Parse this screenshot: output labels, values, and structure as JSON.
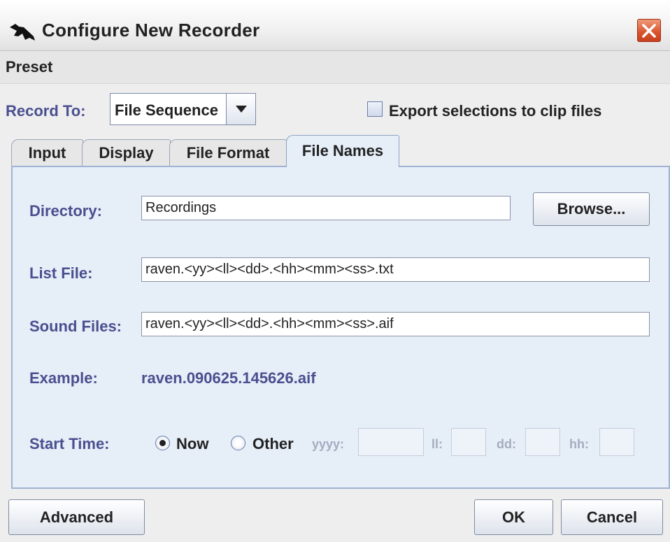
{
  "window": {
    "title": "Configure New Recorder",
    "menu": [
      "Preset"
    ]
  },
  "record": {
    "label": "Record To:",
    "selected": "File Sequence",
    "export_label": "Export selections to clip files",
    "export_checked": false
  },
  "tabs": [
    {
      "label": "Input",
      "active": false
    },
    {
      "label": "Display",
      "active": false
    },
    {
      "label": "File Format",
      "active": false
    },
    {
      "label": "File Names",
      "active": true
    }
  ],
  "file_names": {
    "directory_label": "Directory:",
    "directory_value": "Recordings",
    "browse_label": "Browse...",
    "list_file_label": "List File:",
    "list_file_value": "raven.<yy><ll><dd>.<hh><mm><ss>.txt",
    "sound_files_label": "Sound Files:",
    "sound_files_value": "raven.<yy><ll><dd>.<hh><mm><ss>.aif",
    "example_label": "Example:",
    "example_value": "raven.090625.145626.aif",
    "start_time_label": "Start Time:",
    "now_label": "Now",
    "now_selected": true,
    "other_label": "Other",
    "yyyy_label": "yyyy:",
    "ll_label": "ll:",
    "dd_label": "dd:",
    "hh_label": "hh:"
  },
  "buttons": {
    "advanced": "Advanced",
    "ok": "OK",
    "cancel": "Cancel"
  },
  "colors": {
    "label_blue": "#4a4f8f",
    "panel_bg": "#e6eef8",
    "close_red": "#d9532c"
  }
}
